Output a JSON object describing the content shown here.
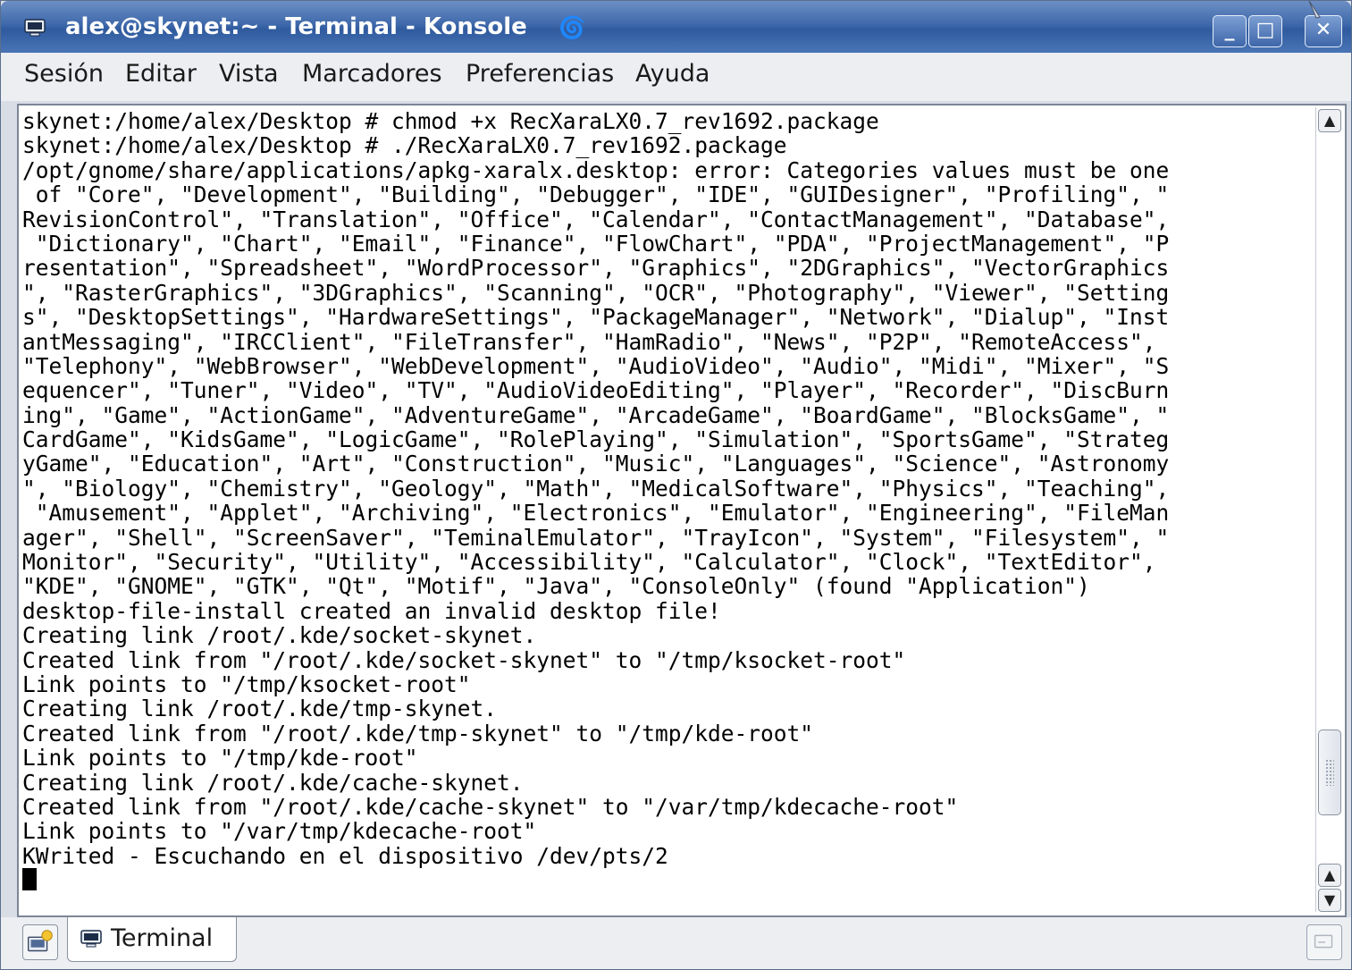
{
  "window": {
    "title": "alex@skynet:~ - Terminal - Konsole",
    "buttons": {
      "minimize": "_",
      "maximize": "□",
      "close": "✕"
    }
  },
  "menubar": {
    "items": [
      "Sesión",
      "Editar",
      "Vista",
      "Marcadores",
      "Preferencias",
      "Ayuda"
    ]
  },
  "terminal": {
    "lines": [
      "skynet:/home/alex/Desktop # chmod +x RecXaraLX0.7_rev1692.package",
      "skynet:/home/alex/Desktop # ./RecXaraLX0.7_rev1692.package",
      "/opt/gnome/share/applications/apkg-xaralx.desktop: error: Categories values must be one",
      " of \"Core\", \"Development\", \"Building\", \"Debugger\", \"IDE\", \"GUIDesigner\", \"Profiling\", \"",
      "RevisionControl\", \"Translation\", \"Office\", \"Calendar\", \"ContactManagement\", \"Database\",",
      " \"Dictionary\", \"Chart\", \"Email\", \"Finance\", \"FlowChart\", \"PDA\", \"ProjectManagement\", \"P",
      "resentation\", \"Spreadsheet\", \"WordProcessor\", \"Graphics\", \"2DGraphics\", \"VectorGraphics",
      "\", \"RasterGraphics\", \"3DGraphics\", \"Scanning\", \"OCR\", \"Photography\", \"Viewer\", \"Setting",
      "s\", \"DesktopSettings\", \"HardwareSettings\", \"PackageManager\", \"Network\", \"Dialup\", \"Inst",
      "antMessaging\", \"IRCClient\", \"FileTransfer\", \"HamRadio\", \"News\", \"P2P\", \"RemoteAccess\",",
      "\"Telephony\", \"WebBrowser\", \"WebDevelopment\", \"AudioVideo\", \"Audio\", \"Midi\", \"Mixer\", \"S",
      "equencer\", \"Tuner\", \"Video\", \"TV\", \"AudioVideoEditing\", \"Player\", \"Recorder\", \"DiscBurn",
      "ing\", \"Game\", \"ActionGame\", \"AdventureGame\", \"ArcadeGame\", \"BoardGame\", \"BlocksGame\", \"",
      "CardGame\", \"KidsGame\", \"LogicGame\", \"RolePlaying\", \"Simulation\", \"SportsGame\", \"Strateg",
      "yGame\", \"Education\", \"Art\", \"Construction\", \"Music\", \"Languages\", \"Science\", \"Astronomy",
      "\", \"Biology\", \"Chemistry\", \"Geology\", \"Math\", \"MedicalSoftware\", \"Physics\", \"Teaching\",",
      " \"Amusement\", \"Applet\", \"Archiving\", \"Electronics\", \"Emulator\", \"Engineering\", \"FileMan",
      "ager\", \"Shell\", \"ScreenSaver\", \"TeminalEmulator\", \"TrayIcon\", \"System\", \"Filesystem\", \"",
      "Monitor\", \"Security\", \"Utility\", \"Accessibility\", \"Calculator\", \"Clock\", \"TextEditor\",",
      "\"KDE\", \"GNOME\", \"GTK\", \"Qt\", \"Motif\", \"Java\", \"ConsoleOnly\" (found \"Application\")",
      "desktop-file-install created an invalid desktop file!",
      "Creating link /root/.kde/socket-skynet.",
      "Created link from \"/root/.kde/socket-skynet\" to \"/tmp/ksocket-root\"",
      "Link points to \"/tmp/ksocket-root\"",
      "Creating link /root/.kde/tmp-skynet.",
      "Created link from \"/root/.kde/tmp-skynet\" to \"/tmp/kde-root\"",
      "Link points to \"/tmp/kde-root\"",
      "Creating link /root/.kde/cache-skynet.",
      "Created link from \"/root/.kde/cache-skynet\" to \"/var/tmp/kdecache-root\"",
      "Link points to \"/var/tmp/kdecache-root\"",
      "KWrited - Escuchando en el dispositivo /dev/pts/2"
    ],
    "scroll_position": 0.93
  },
  "tabbar": {
    "tabs": [
      {
        "label": "Terminal",
        "icon": "terminal-icon"
      }
    ]
  },
  "colors": {
    "titlebar": "#3f69ab",
    "chrome": "#eceef2",
    "terminal_bg": "#ffffff",
    "terminal_fg": "#000000"
  }
}
